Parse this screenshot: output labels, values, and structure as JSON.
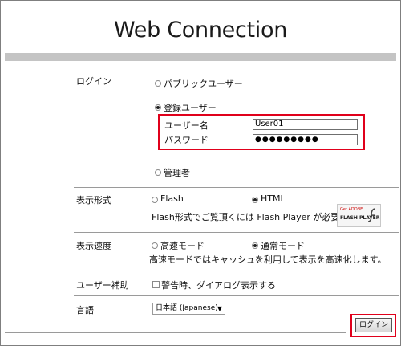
{
  "title": "Web Connection",
  "login": {
    "label": "ログイン",
    "public_user": "パブリックユーザー",
    "registered_user": "登録ユーザー",
    "username_label": "ユーザー名",
    "username_value": "User01",
    "password_label": "パスワード",
    "password_value": "●●●●●●●●●",
    "admin": "管理者"
  },
  "display_format": {
    "label": "表示形式",
    "options": [
      "Flash",
      "HTML"
    ],
    "selected": "HTML",
    "flash_note": "Flash形式でご覧頂くには Flash Player が必要です。",
    "badge_line1": "Get ADOBE",
    "badge_line2": "FLASH PLAYER",
    "badge_icon": "flash-player-icon"
  },
  "display_speed": {
    "label": "表示速度",
    "options": [
      "高速モード",
      "通常モード"
    ],
    "selected": "通常モード",
    "note": "高速モードではキャッシュを利用して表示を高速化します。"
  },
  "user_assist": {
    "label": "ユーザー補助",
    "checkbox_label": "警告時、ダイアログ表示する",
    "checked": false
  },
  "language": {
    "label": "言語",
    "selected": "日本語 (Japanese)"
  },
  "login_button": "ログイン",
  "colors": {
    "highlight_red": "#e0001b",
    "top_bar": "#c4c4c4"
  }
}
